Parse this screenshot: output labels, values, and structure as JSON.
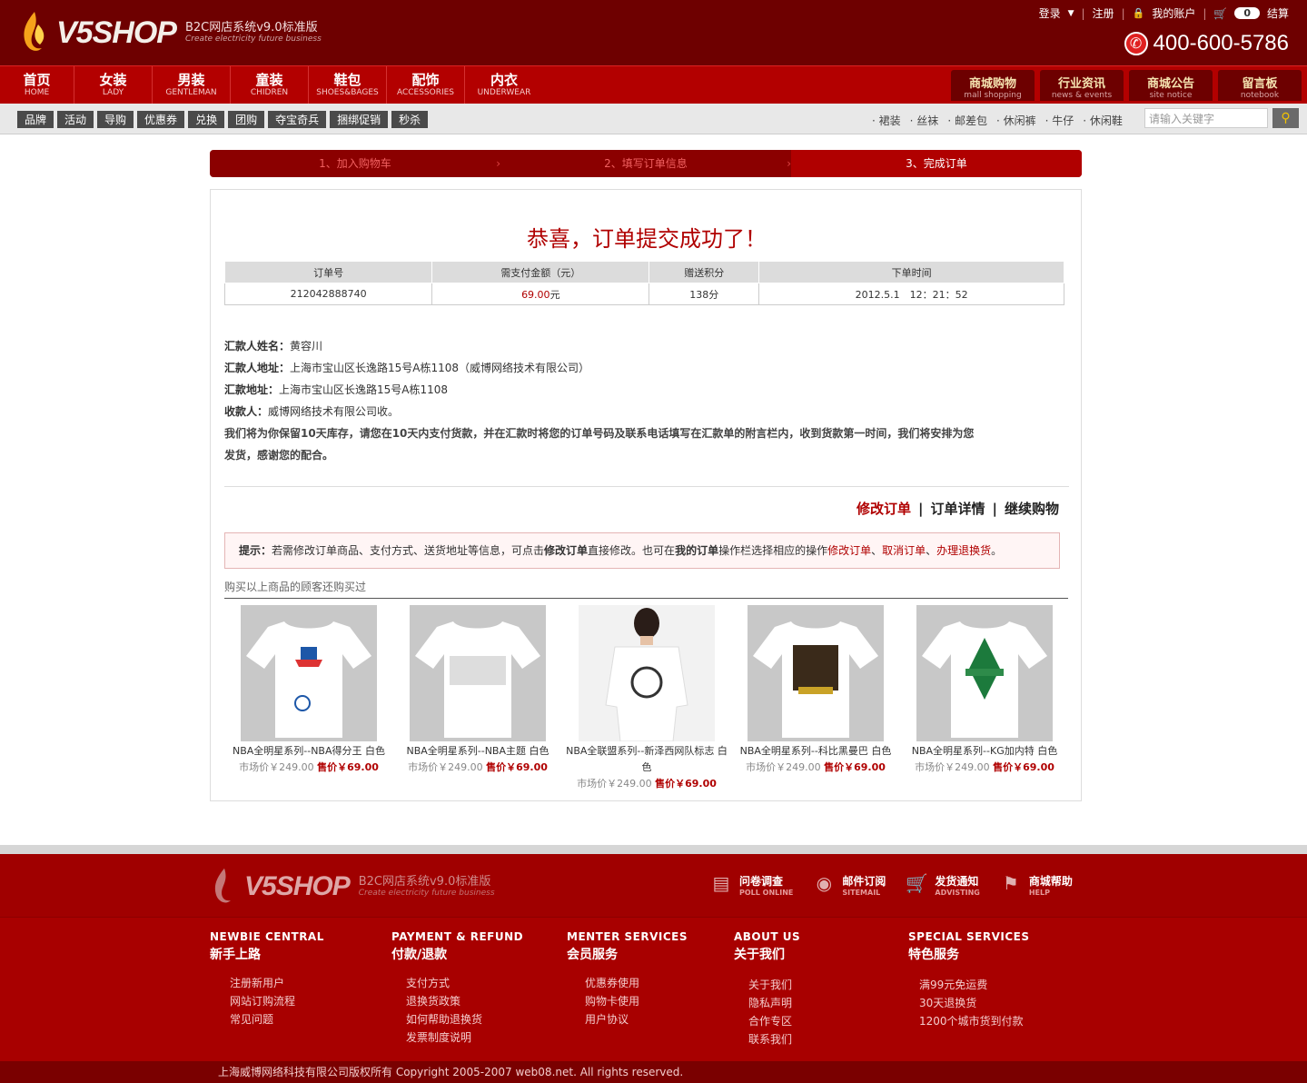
{
  "header": {
    "logo": "V5SHOP",
    "logo_sub1": "B2C网店系统v9.0标准版",
    "logo_sub2": "Create electricity future business",
    "login": "登录",
    "register": "注册",
    "account": "我的账户",
    "cart_count": "0",
    "checkout": "结算",
    "hotline": "400-600-5786"
  },
  "nav": [
    {
      "cn": "首页",
      "en": "HOME"
    },
    {
      "cn": "女装",
      "en": "LADY"
    },
    {
      "cn": "男装",
      "en": "GENTLEMAN"
    },
    {
      "cn": "童装",
      "en": "CHIDREN"
    },
    {
      "cn": "鞋包",
      "en": "SHOES&BAGES"
    },
    {
      "cn": "配饰",
      "en": "ACCESSORIES"
    },
    {
      "cn": "内衣",
      "en": "UNDERWEAR"
    }
  ],
  "nav_right": [
    {
      "cn": "商城购物",
      "en": "mall shopping"
    },
    {
      "cn": "行业资讯",
      "en": "news & events"
    },
    {
      "cn": "商城公告",
      "en": "site notice"
    },
    {
      "cn": "留言板",
      "en": "notebook"
    }
  ],
  "tags": [
    "品牌",
    "活动",
    "导购",
    "优惠券",
    "兑换",
    "团购",
    "夺宝奇兵",
    "捆绑促销",
    "秒杀"
  ],
  "hotwords": [
    "裙装",
    "丝袜",
    "邮差包",
    "休闲裤",
    "牛仔",
    "休闲鞋"
  ],
  "search": {
    "placeholder": "请输入关键字"
  },
  "steps": [
    "1、加入购物车",
    "2、填写订单信息",
    "3、完成订单"
  ],
  "congrats": "恭喜，订单提交成功了！",
  "order_table": {
    "headers": [
      "订单号",
      "需支付金额（元）",
      "赠送积分",
      "下单时间"
    ],
    "order_no": "212042888740",
    "amount": "69.00",
    "amount_unit": "元",
    "points": "138分",
    "time": "2012.5.1　12：21：52"
  },
  "info": {
    "name_label": "汇款人姓名：",
    "name": "黄容川",
    "addr_label": "汇款人地址：",
    "addr": "上海市宝山区长逸路15号A栋1108（威博网络技术有限公司）",
    "remit_label": "汇款地址：",
    "remit": "上海市宝山区长逸路15号A栋1108",
    "payee_label": "收款人：",
    "payee": "威博网络技术有限公司收。",
    "note": "我们将为你保留10天库存，请您在10天内支付货款，并在汇款时将您的订单号码及联系电话填写在汇款单的附言栏内，收到货款第一时间，我们将安排为您",
    "note2": "发货，感谢您的配合。"
  },
  "actions": {
    "modify": "修改订单",
    "detail": "订单详情",
    "continue": "继续购物"
  },
  "tip": {
    "label": "提示：",
    "t1": "若需修改订单商品、支付方式、送货地址等信息，可点击",
    "b1": "修改订单",
    "t2": "直接修改。也可在",
    "b2": "我的订单",
    "t3": "操作栏选择相应的操作",
    "l1": "修改订单",
    "l2": "取消订单",
    "l3": "办理退换货",
    "sep": "、",
    "end": "。"
  },
  "also_bought": "购买以上商品的顾客还购买过",
  "products": [
    {
      "name": "NBA全明星系列--NBA得分王 白色",
      "market": "市场价￥249.00",
      "sale": "售价￥69.00"
    },
    {
      "name": "NBA全明星系列--NBA主题 白色",
      "market": "市场价￥249.00",
      "sale": "售价￥69.00"
    },
    {
      "name": "NBA全联盟系列--新泽西网队标志 白色",
      "market": "市场价￥249.00",
      "sale": "售价￥69.00"
    },
    {
      "name": "NBA全明星系列--科比黑曼巴 白色",
      "market": "市场价￥249.00",
      "sale": "售价￥69.00"
    },
    {
      "name": "NBA全明星系列--KG加内特 白色",
      "market": "市场价￥249.00",
      "sale": "售价￥69.00"
    }
  ],
  "footer": {
    "icons": [
      {
        "cn": "问卷调查",
        "en": "POLL ONLINE"
      },
      {
        "cn": "邮件订阅",
        "en": "SITEMAIL"
      },
      {
        "cn": "发货通知",
        "en": "ADVISTING"
      },
      {
        "cn": "商城帮助",
        "en": "HELP"
      }
    ],
    "cols": [
      {
        "en": "NEWBIE CENTRAL",
        "cn": "新手上路",
        "items": [
          "注册新用户",
          "网站订购流程",
          "常见问题"
        ]
      },
      {
        "en": "PAYMENT & REFUND",
        "cn": "付款/退款",
        "items": [
          "支付方式",
          "退换货政策",
          "如何帮助退换货",
          "发票制度说明"
        ]
      },
      {
        "en": "MENTER SERVICES",
        "cn": "会员服务",
        "items": [
          "优惠券使用",
          "购物卡使用",
          "用户协议"
        ]
      },
      {
        "en": "ABOUT US",
        "cn": "关于我们",
        "items": [
          "关于我们",
          "隐私声明",
          "合作专区",
          "联系我们"
        ]
      },
      {
        "en": "SPECIAL SERVICES",
        "cn": "特色服务",
        "items": [
          "满99元免运费",
          "30天退换货",
          "1200个城市货到付款"
        ]
      }
    ],
    "copyright": "上海威博网络科技有限公司版权所有  Copyright 2005-2007 web08.net. All rights reserved."
  }
}
